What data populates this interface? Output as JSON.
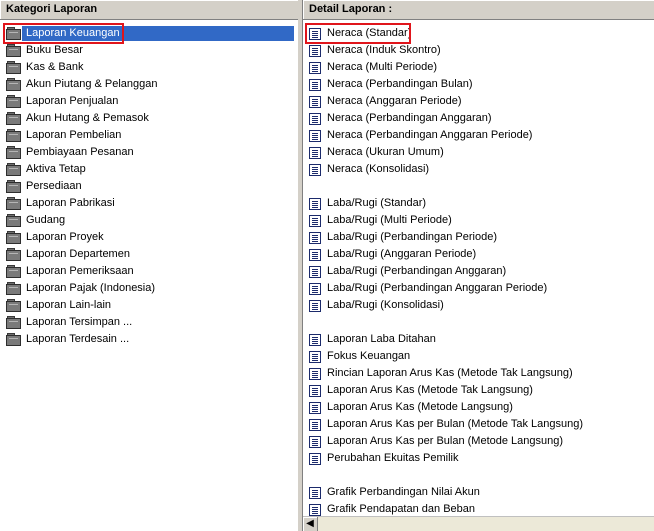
{
  "left_panel": {
    "header": "Kategori Laporan",
    "items": [
      {
        "label": "Laporan Keuangan",
        "selected": true
      },
      {
        "label": "Buku Besar"
      },
      {
        "label": "Kas & Bank"
      },
      {
        "label": "Akun Piutang & Pelanggan"
      },
      {
        "label": "Laporan Penjualan"
      },
      {
        "label": "Akun Hutang & Pemasok"
      },
      {
        "label": "Laporan Pembelian"
      },
      {
        "label": "Pembiayaan Pesanan"
      },
      {
        "label": "Aktiva Tetap"
      },
      {
        "label": "Persediaan"
      },
      {
        "label": "Laporan Pabrikasi"
      },
      {
        "label": "Gudang"
      },
      {
        "label": "Laporan Proyek"
      },
      {
        "label": "Laporan Departemen"
      },
      {
        "label": "Laporan Pemeriksaan"
      },
      {
        "label": "Laporan Pajak (Indonesia)"
      },
      {
        "label": "Laporan Lain-lain"
      },
      {
        "label": "Laporan Tersimpan ..."
      },
      {
        "label": "Laporan Terdesain ..."
      }
    ]
  },
  "right_panel": {
    "header": "Detail Laporan :",
    "items": [
      {
        "label": "Neraca (Standar)"
      },
      {
        "label": "Neraca (Induk Skontro)"
      },
      {
        "label": "Neraca (Multi Periode)"
      },
      {
        "label": "Neraca (Perbandingan Bulan)"
      },
      {
        "label": "Neraca (Anggaran Periode)"
      },
      {
        "label": "Neraca (Perbandingan Anggaran)"
      },
      {
        "label": "Neraca (Perbandingan Anggaran Periode)"
      },
      {
        "label": "Neraca (Ukuran Umum)"
      },
      {
        "label": "Neraca (Konsolidasi)"
      },
      {
        "label": ""
      },
      {
        "label": "Laba/Rugi (Standar)"
      },
      {
        "label": "Laba/Rugi (Multi Periode)"
      },
      {
        "label": "Laba/Rugi (Perbandingan Periode)"
      },
      {
        "label": "Laba/Rugi (Anggaran Periode)"
      },
      {
        "label": "Laba/Rugi (Perbandingan Anggaran)"
      },
      {
        "label": "Laba/Rugi (Perbandingan Anggaran Periode)"
      },
      {
        "label": "Laba/Rugi (Konsolidasi)"
      },
      {
        "label": ""
      },
      {
        "label": "Laporan Laba Ditahan"
      },
      {
        "label": "Fokus Keuangan"
      },
      {
        "label": "Rincian Laporan Arus Kas (Metode Tak Langsung)"
      },
      {
        "label": "Laporan Arus Kas (Metode Tak Langsung)"
      },
      {
        "label": "Laporan Arus Kas (Metode Langsung)"
      },
      {
        "label": "Laporan Arus Kas per Bulan (Metode Tak Langsung)"
      },
      {
        "label": "Laporan Arus Kas per Bulan (Metode Langsung)"
      },
      {
        "label": "Perubahan Ekuitas Pemilik"
      },
      {
        "label": ""
      },
      {
        "label": "Grafik Perbandingan Nilai Akun"
      },
      {
        "label": "Grafik Pendapatan dan Beban"
      }
    ]
  },
  "scrollbar": {
    "left_arrow": "◀"
  },
  "colors": {
    "selection": "#3169c6",
    "highlight": "#e0151b",
    "chrome": "#d4d0c8"
  }
}
